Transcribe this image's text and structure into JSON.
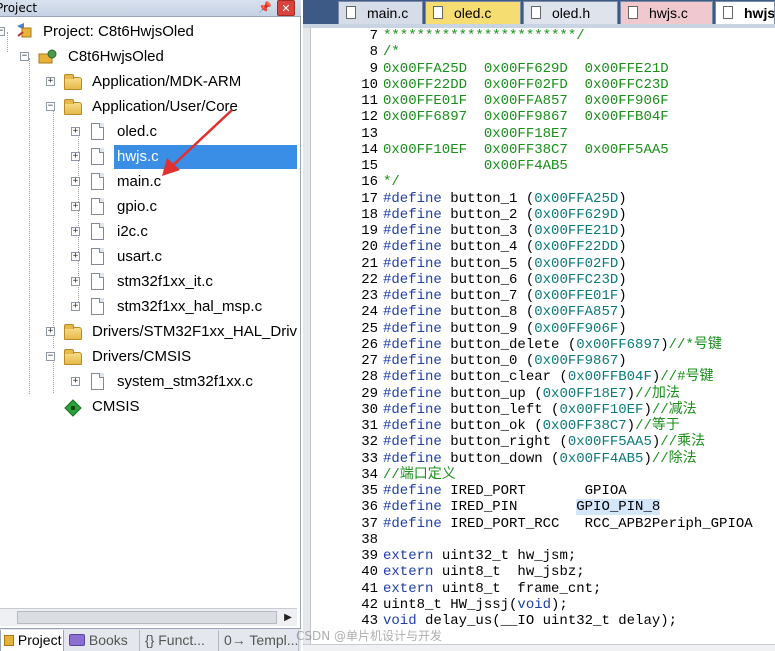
{
  "project_pane": {
    "title": "Project",
    "pin_icon": "pin-icon",
    "close_icon": "close-icon",
    "tree": [
      {
        "label": "Project: C8t6HwjsOled",
        "kind": "root"
      },
      {
        "label": "C8t6HwjsOled",
        "kind": "target"
      },
      {
        "label": "Application/MDK-ARM",
        "kind": "folder"
      },
      {
        "label": "Application/User/Core",
        "kind": "folder"
      },
      {
        "label": "oled.c",
        "kind": "file"
      },
      {
        "label": "hwjs.c",
        "kind": "file",
        "selected": true
      },
      {
        "label": "main.c",
        "kind": "file"
      },
      {
        "label": "gpio.c",
        "kind": "file"
      },
      {
        "label": "i2c.c",
        "kind": "file"
      },
      {
        "label": "usart.c",
        "kind": "file"
      },
      {
        "label": "stm32f1xx_it.c",
        "kind": "file"
      },
      {
        "label": "stm32f1xx_hal_msp.c",
        "kind": "file"
      },
      {
        "label": "Drivers/STM32F1xx_HAL_Driver",
        "kind": "folder"
      },
      {
        "label": "Drivers/CMSIS",
        "kind": "folder"
      },
      {
        "label": "system_stm32f1xx.c",
        "kind": "file"
      },
      {
        "label": "CMSIS",
        "kind": "component"
      }
    ],
    "bottom_tabs": [
      "Project",
      "Books",
      "{} Funct...",
      "0→ Templ..."
    ]
  },
  "editor": {
    "tabs": [
      {
        "label": "main.c",
        "color": "#d6dde8"
      },
      {
        "label": "oled.c",
        "color": "#f6dd72"
      },
      {
        "label": "oled.h",
        "color": "#dfe4ec"
      },
      {
        "label": "hwjs.c",
        "color": "#f0c9cf"
      },
      {
        "label": "hwjs.",
        "color": "#ffffff",
        "active": true
      }
    ],
    "code_lines": [
      {
        "n": "7",
        "text": "***********************/"
      },
      {
        "n": "8",
        "text": "/*"
      },
      {
        "n": "9",
        "text": "0x00FFA25D  0x00FF629D  0x00FFE21D"
      },
      {
        "n": "10",
        "text": "0x00FF22DD  0x00FF02FD  0x00FFC23D"
      },
      {
        "n": "11",
        "text": "0x00FFE01F  0x00FFA857  0x00FF906F"
      },
      {
        "n": "12",
        "text": "0x00FF6897  0x00FF9867  0x00FFB04F"
      },
      {
        "n": "13",
        "text": "            0x00FF18E7"
      },
      {
        "n": "14",
        "text": "0x00FF10EF  0x00FF38C7  0x00FF5AA5"
      },
      {
        "n": "15",
        "text": "            0x00FF4AB5"
      },
      {
        "n": "16",
        "text": "*/"
      },
      {
        "n": "17",
        "text": "#define button_1 (0x00FFA25D)"
      },
      {
        "n": "18",
        "text": "#define button_2 (0x00FF629D)"
      },
      {
        "n": "19",
        "text": "#define button_3 (0x00FFE21D)"
      },
      {
        "n": "20",
        "text": "#define button_4 (0x00FF22DD)"
      },
      {
        "n": "21",
        "text": "#define button_5 (0x00FF02FD)"
      },
      {
        "n": "22",
        "text": "#define button_6 (0x00FFC23D)"
      },
      {
        "n": "23",
        "text": "#define button_7 (0x00FFE01F)"
      },
      {
        "n": "24",
        "text": "#define button_8 (0x00FFA857)"
      },
      {
        "n": "25",
        "text": "#define button_9 (0x00FF906F)"
      },
      {
        "n": "26",
        "text": "#define button_delete (0x00FF6897)//*号键"
      },
      {
        "n": "27",
        "text": "#define button_0 (0x00FF9867)"
      },
      {
        "n": "28",
        "text": "#define button_clear (0x00FFB04F)//#号键"
      },
      {
        "n": "29",
        "text": "#define button_up (0x00FF18E7)//加法"
      },
      {
        "n": "30",
        "text": "#define button_left (0x00FF10EF)//减法"
      },
      {
        "n": "31",
        "text": "#define button_ok (0x00FF38C7)//等于"
      },
      {
        "n": "32",
        "text": "#define button_right (0x00FF5AA5)//乘法"
      },
      {
        "n": "33",
        "text": "#define button_down (0x00FF4AB5)//除法"
      },
      {
        "n": "34",
        "text": "//端口定义"
      },
      {
        "n": "35",
        "text": "#define IRED_PORT       GPIOA"
      },
      {
        "n": "36",
        "text": "#define IRED_PIN       GPIO_PIN_8"
      },
      {
        "n": "37",
        "text": "#define IRED_PORT_RCC   RCC_APB2Periph_GPIOA"
      },
      {
        "n": "38",
        "text": ""
      },
      {
        "n": "39",
        "text": "extern uint32_t hw_jsm;"
      },
      {
        "n": "40",
        "text": "extern uint8_t  hw_jsbz;"
      },
      {
        "n": "41",
        "text": "extern uint8_t  frame_cnt;"
      },
      {
        "n": "42",
        "text": "uint8_t HW_jssj(void);"
      },
      {
        "n": "43",
        "text": "void delay_us(__IO uint32_t delay);"
      }
    ]
  },
  "watermark": "CSDN @单片机设计与开发",
  "colors": {
    "selection": "#3a8ee6",
    "comment": "#1a8f1a",
    "keyword": "#1f3fa6",
    "number": "#0b7a7a",
    "arrow": "#e03030"
  }
}
